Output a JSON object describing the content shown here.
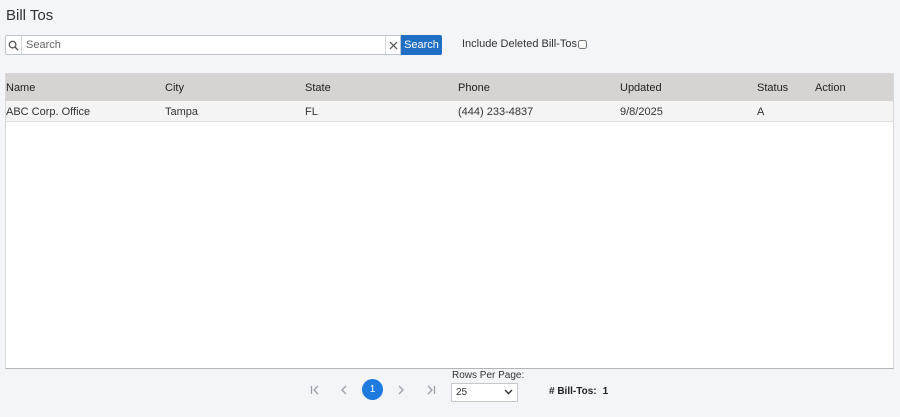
{
  "page": {
    "title": "Bill Tos"
  },
  "search": {
    "placeholder": "Search",
    "value": "",
    "button_label": "Search"
  },
  "filter": {
    "include_deleted_label": "Include Deleted Bill-Tos",
    "include_deleted_checked": false
  },
  "table": {
    "columns": [
      "Name",
      "City",
      "State",
      "Phone",
      "Updated",
      "Status",
      "Action"
    ],
    "rows": [
      {
        "name": "ABC Corp. Office",
        "city": "Tampa",
        "state": "FL",
        "phone": "(444) 233-4837",
        "updated": "9/8/2025",
        "status": "A",
        "action": ""
      }
    ]
  },
  "pagination": {
    "first_icon": "first-page-icon",
    "prev_icon": "prev-page-icon",
    "next_icon": "next-page-icon",
    "last_icon": "last-page-icon",
    "current_page": "1",
    "rows_per_page_label": "Rows Per Page:",
    "rows_per_page_value": "25"
  },
  "summary": {
    "count_label": "# Bill-Tos:",
    "count_value": "1"
  },
  "colors": {
    "accent": "#1f6fc4",
    "page_active": "#1f7ae0",
    "header_bg": "#d6d3d3"
  }
}
